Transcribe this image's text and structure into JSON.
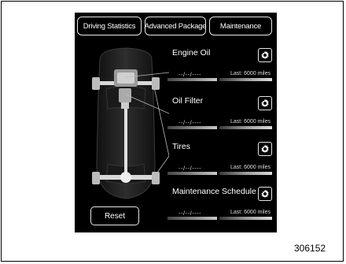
{
  "tabs": {
    "driving_statistics": "Driving Statistics",
    "advanced_package": "Advanced Package",
    "maintenance": "Maintenance"
  },
  "items": [
    {
      "label": "Engine Oil",
      "date": "--/--/----",
      "last": "Last: 6000 miles",
      "icon": "gear-icon"
    },
    {
      "label": "Oil Filter",
      "date": "--/--/----",
      "last": "Last: 6000 miles",
      "icon": "gear-icon"
    },
    {
      "label": "Tires",
      "date": "--/--/----",
      "last": "Last: 6000 miles",
      "icon": "gear-icon"
    },
    {
      "label": "Maintenance Schedule",
      "date": "--/--/----",
      "last": "Last: 6000 miles",
      "icon": "gear-icon"
    }
  ],
  "reset_label": "Reset",
  "figure_number": "306152",
  "colors": {
    "screen_background": "#000000",
    "text": "#ffffff",
    "border": "#e6e6e6"
  }
}
